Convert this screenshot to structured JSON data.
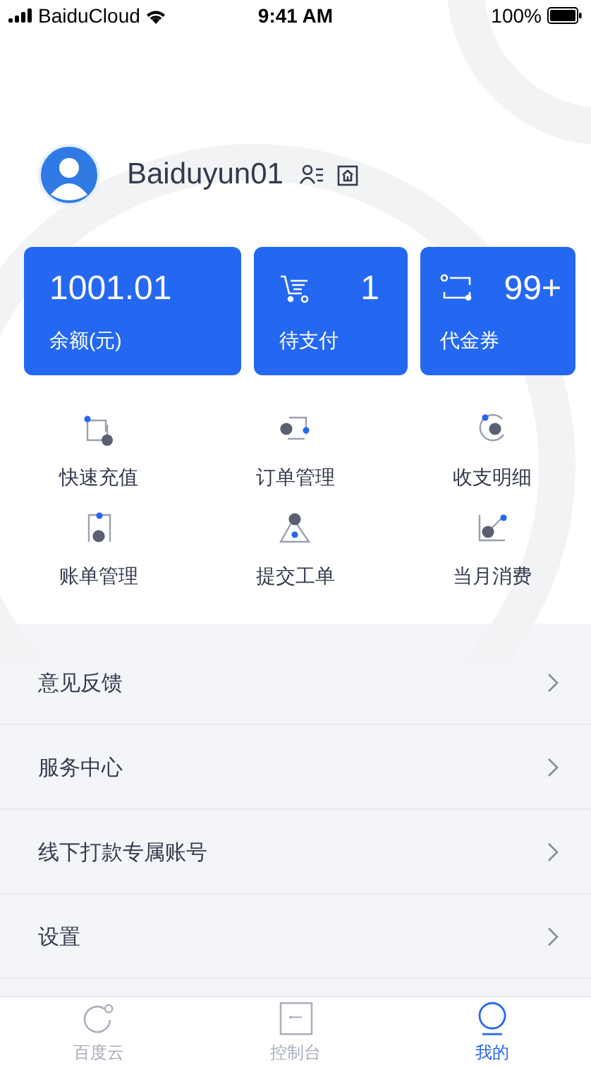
{
  "status_bar": {
    "carrier": "BaiduCloud",
    "time": "9:41 AM",
    "battery": "100%"
  },
  "profile": {
    "username": "Baiduyun01"
  },
  "summary_cards": [
    {
      "value": "1001.01",
      "label": "余额(元)"
    },
    {
      "value": "1",
      "label": "待支付"
    },
    {
      "value": "99+",
      "label": "代金券"
    }
  ],
  "shortcuts": [
    "快速充值",
    "订单管理",
    "收支明细",
    "账单管理",
    "提交工单",
    "当月消费"
  ],
  "menu": [
    "意见反馈",
    "服务中心",
    "线下打款专属账号",
    "设置"
  ],
  "tab_bar": [
    {
      "label": "百度云",
      "selected": false
    },
    {
      "label": "控制台",
      "selected": false
    },
    {
      "label": "我的",
      "selected": true
    }
  ]
}
